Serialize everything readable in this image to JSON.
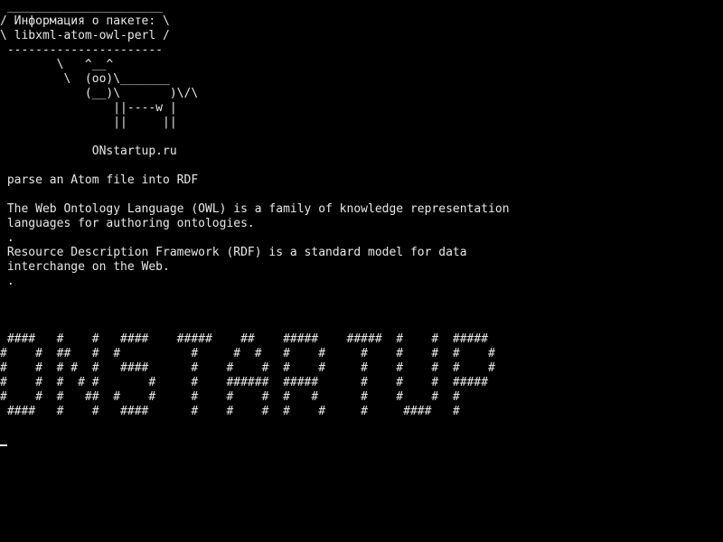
{
  "terminal": {
    "colors": {
      "background": "#000000",
      "foreground": "#e8e8e8"
    },
    "cowsay": {
      "bubble": [
        " ______________________",
        "/ Информация о пакете: \\",
        "\\ libxml-atom-owl-perl /",
        " ----------------------"
      ],
      "cow": [
        "        \\   ^__^",
        "         \\  (oo)\\_______",
        "            (__)\\       )\\/\\",
        "                ||----w |",
        "                ||     ||"
      ]
    },
    "site_label": "             ONstartup.ru",
    "package_info": [
      " parse an Atom file into RDF",
      "",
      " The Web Ontology Language (OWL) is a family of knowledge representation",
      " languages for authoring ontologies.",
      " .",
      " Resource Description Framework (RDF) is a standard model for data",
      " interchange on the Web.",
      " ."
    ],
    "banner": [
      " ####   #    #   ####    #####    ##    #####    #####  #    #  #####",
      "#    #  ##   #  #          #     #  #   #    #     #    #    #  #    #",
      "#    #  # #  #   ####      #    #    #  #    #     #    #    #  #    #",
      "#    #  #  # #       #     #    ######  #####      #    #    #  #####",
      "#    #  #   ##  #    #     #    #    #  #   #      #    #    #  #",
      " ####   #    #   ####      #    #    #  #    #     #     ####   #"
    ]
  }
}
